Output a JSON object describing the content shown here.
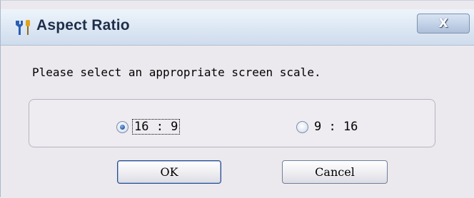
{
  "window": {
    "title": "Aspect Ratio",
    "close_label": "X",
    "icon": "tools-icon"
  },
  "dialog": {
    "prompt": "Please select an appropriate screen scale.",
    "options": [
      {
        "label": "16 : 9",
        "selected": true
      },
      {
        "label": "9 : 16",
        "selected": false
      }
    ],
    "ok_label": "OK",
    "cancel_label": "Cancel"
  },
  "colors": {
    "radio_selected": "#2f64b9",
    "title_text": "#1f2f4a"
  }
}
